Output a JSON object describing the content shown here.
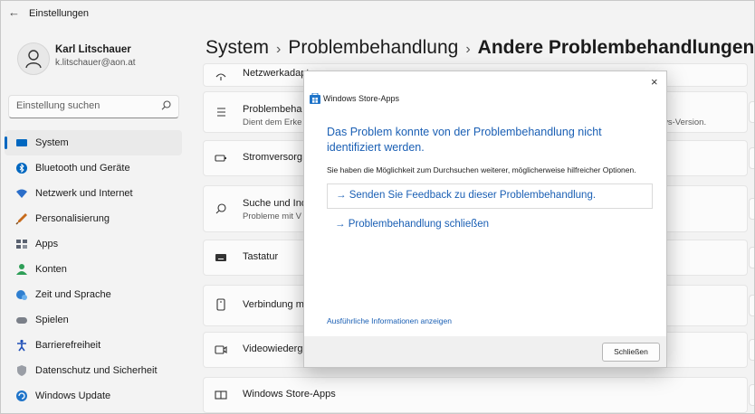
{
  "window": {
    "title": "Einstellungen",
    "back_glyph": "←"
  },
  "user": {
    "name": "Karl Litschauer",
    "email": "k.litschauer@aon.at"
  },
  "search": {
    "placeholder": "Einstellung suchen"
  },
  "nav": {
    "items": [
      {
        "label": "System",
        "icon": "system-icon",
        "color": "#0067c0"
      },
      {
        "label": "Bluetooth und Geräte",
        "icon": "bluetooth-icon",
        "color": "#0067c0"
      },
      {
        "label": "Netzwerk und Internet",
        "icon": "wifi-icon",
        "color": "#2b6ec9"
      },
      {
        "label": "Personalisierung",
        "icon": "brush-icon",
        "color": "#c76a1b"
      },
      {
        "label": "Apps",
        "icon": "apps-icon",
        "color": "#5a6270"
      },
      {
        "label": "Konten",
        "icon": "person-icon",
        "color": "#2e9e57"
      },
      {
        "label": "Zeit und Sprache",
        "icon": "globe-clock-icon",
        "color": "#2f7fd0"
      },
      {
        "label": "Spielen",
        "icon": "gamepad-icon",
        "color": "#7b8089"
      },
      {
        "label": "Barrierefreiheit",
        "icon": "accessibility-icon",
        "color": "#1f4fb8"
      },
      {
        "label": "Datenschutz und Sicherheit",
        "icon": "shield-icon",
        "color": "#7a7e86"
      },
      {
        "label": "Windows Update",
        "icon": "update-icon",
        "color": "#1f74c9"
      }
    ],
    "active_index": 0
  },
  "breadcrumb": {
    "part1": "System",
    "part2": "Problembehandlung",
    "part3": "Andere Problembehandlungen",
    "separator": "›"
  },
  "list": {
    "items": [
      {
        "title": "Netzwerkadapter",
        "subtitle": "",
        "extra": "",
        "icon": "network-adapter-icon"
      },
      {
        "title": "Problembeha",
        "subtitle": "Dient dem Erke",
        "extra": "ws-Version.",
        "icon": "program-compat-icon"
      },
      {
        "title": "Stromversorg",
        "subtitle": "",
        "extra": "",
        "icon": "battery-icon"
      },
      {
        "title": "Suche und Ind",
        "subtitle": "Probleme mit V",
        "extra": "",
        "icon": "search-icon"
      },
      {
        "title": "Tastatur",
        "subtitle": "",
        "extra": "",
        "icon": "keyboard-icon"
      },
      {
        "title": "Verbindung m",
        "subtitle": "",
        "extra": "",
        "icon": "phone-icon"
      },
      {
        "title": "Videowiederg",
        "subtitle": "",
        "extra": "",
        "icon": "video-icon"
      },
      {
        "title": "Windows Store-Apps",
        "subtitle": "",
        "extra": "",
        "icon": "store-apps-icon"
      }
    ]
  },
  "dialog": {
    "title": "Windows Store-Apps",
    "close_glyph": "×",
    "heading": "Das Problem konnte von der Problembehandlung nicht identifiziert werden.",
    "subtext": "Sie haben die Möglichkeit zum Durchsuchen weiterer, möglicherweise hilfreicher Optionen.",
    "link_feedback": "→ Senden Sie Feedback zu dieser Problembehandlung.",
    "link_close": "→ Problembehandlung schließen",
    "details_link": "Ausführliche Informationen anzeigen",
    "close_button": "Schließen"
  }
}
